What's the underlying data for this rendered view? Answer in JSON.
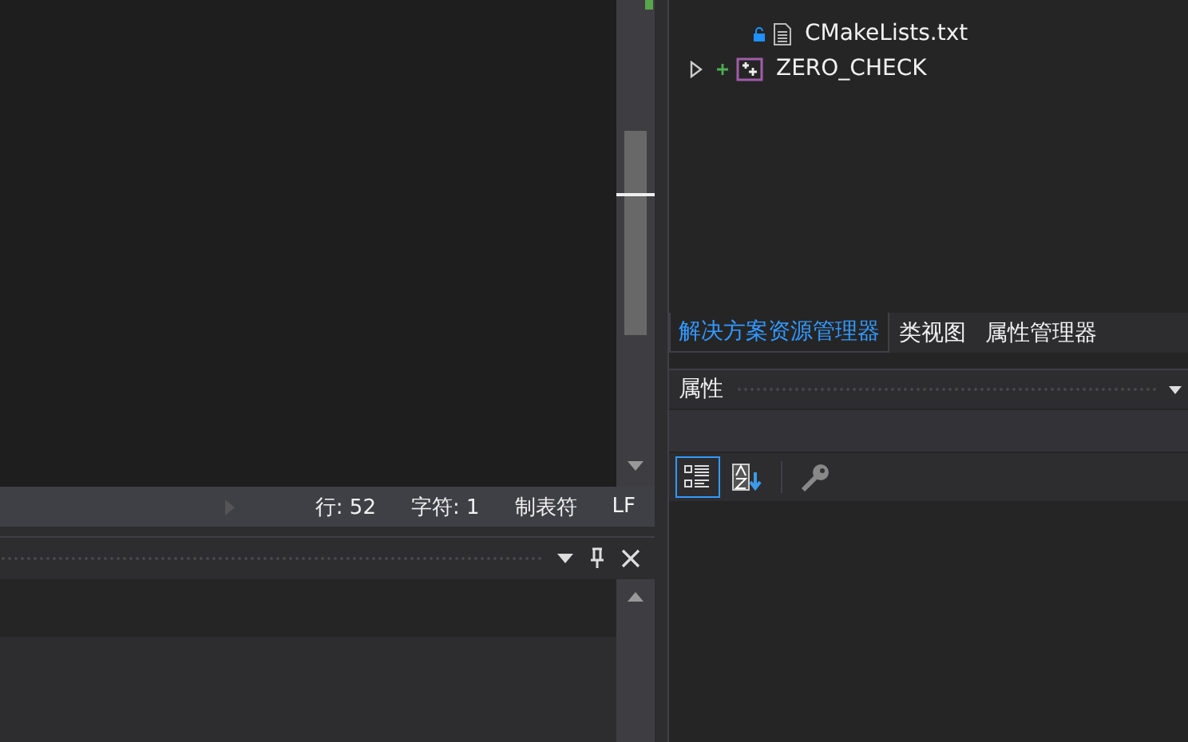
{
  "solution_tree": {
    "items": [
      {
        "label": "CMakeLists.txt",
        "kind": "file"
      },
      {
        "label": "ZERO_CHECK",
        "kind": "project",
        "expanded": false
      }
    ]
  },
  "status_bar": {
    "items": [
      "行: 52",
      "字符: 1",
      "制表符",
      "LF"
    ]
  },
  "tabs": [
    {
      "label": "解决方案资源管理器",
      "selected": true
    },
    {
      "label": "类视图",
      "selected": false
    },
    {
      "label": "属性管理器",
      "selected": false
    }
  ],
  "properties": {
    "title": "属性",
    "toolbar": [
      {
        "kind": "categorized",
        "selected": true
      },
      {
        "kind": "alphabetical",
        "selected": false
      },
      {
        "kind": "pages",
        "selected": false
      }
    ]
  }
}
